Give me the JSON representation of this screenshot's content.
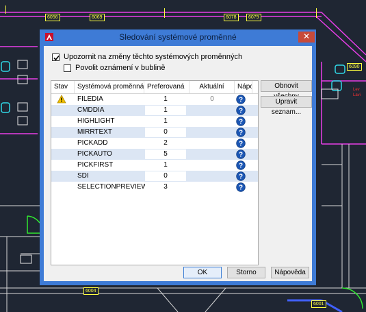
{
  "cad_background": {
    "tags": [
      "6056",
      "6069",
      "6078",
      "6079",
      "6090",
      "6001",
      "6004"
    ],
    "red_labels": [
      "Lev",
      "Lavi"
    ]
  },
  "dialog": {
    "title": "Sledování systémové proměnné",
    "close_glyph": "✕",
    "notify_checkbox": {
      "label": "Upozornit na změny těchto systémových proměnných",
      "checked": true
    },
    "bubble_checkbox": {
      "label": "Povolit oznámení v bublině",
      "checked": false
    },
    "table": {
      "columns": [
        "Stav",
        "Systémová proměnná",
        "Preferovaná",
        "Aktuální",
        "Nápo"
      ],
      "rows": [
        {
          "status_icon": "warning-icon",
          "name": "FILEDIA",
          "preferred": "1",
          "current": "0"
        },
        {
          "status_icon": "",
          "name": "CMDDIA",
          "preferred": "1",
          "current": ""
        },
        {
          "status_icon": "",
          "name": "HIGHLIGHT",
          "preferred": "1",
          "current": ""
        },
        {
          "status_icon": "",
          "name": "MIRRTEXT",
          "preferred": "0",
          "current": ""
        },
        {
          "status_icon": "",
          "name": "PICKADD",
          "preferred": "2",
          "current": ""
        },
        {
          "status_icon": "",
          "name": "PICKAUTO",
          "preferred": "5",
          "current": ""
        },
        {
          "status_icon": "",
          "name": "PICKFIRST",
          "preferred": "1",
          "current": ""
        },
        {
          "status_icon": "",
          "name": "SDI",
          "preferred": "0",
          "current": ""
        },
        {
          "status_icon": "",
          "name": "SELECTIONPREVIEW",
          "preferred": "3",
          "current": ""
        }
      ]
    },
    "buttons": {
      "reset_all": "Obnovit všechny",
      "edit_list": "Upravit seznam...",
      "ok": "OK",
      "cancel": "Storno",
      "help": "Nápověda"
    },
    "colors": {
      "title_bar": "#3e7bd6",
      "alt_row": "#dce6f4",
      "help_icon": "#1c57b5",
      "warning_icon": "#f2c200"
    }
  }
}
